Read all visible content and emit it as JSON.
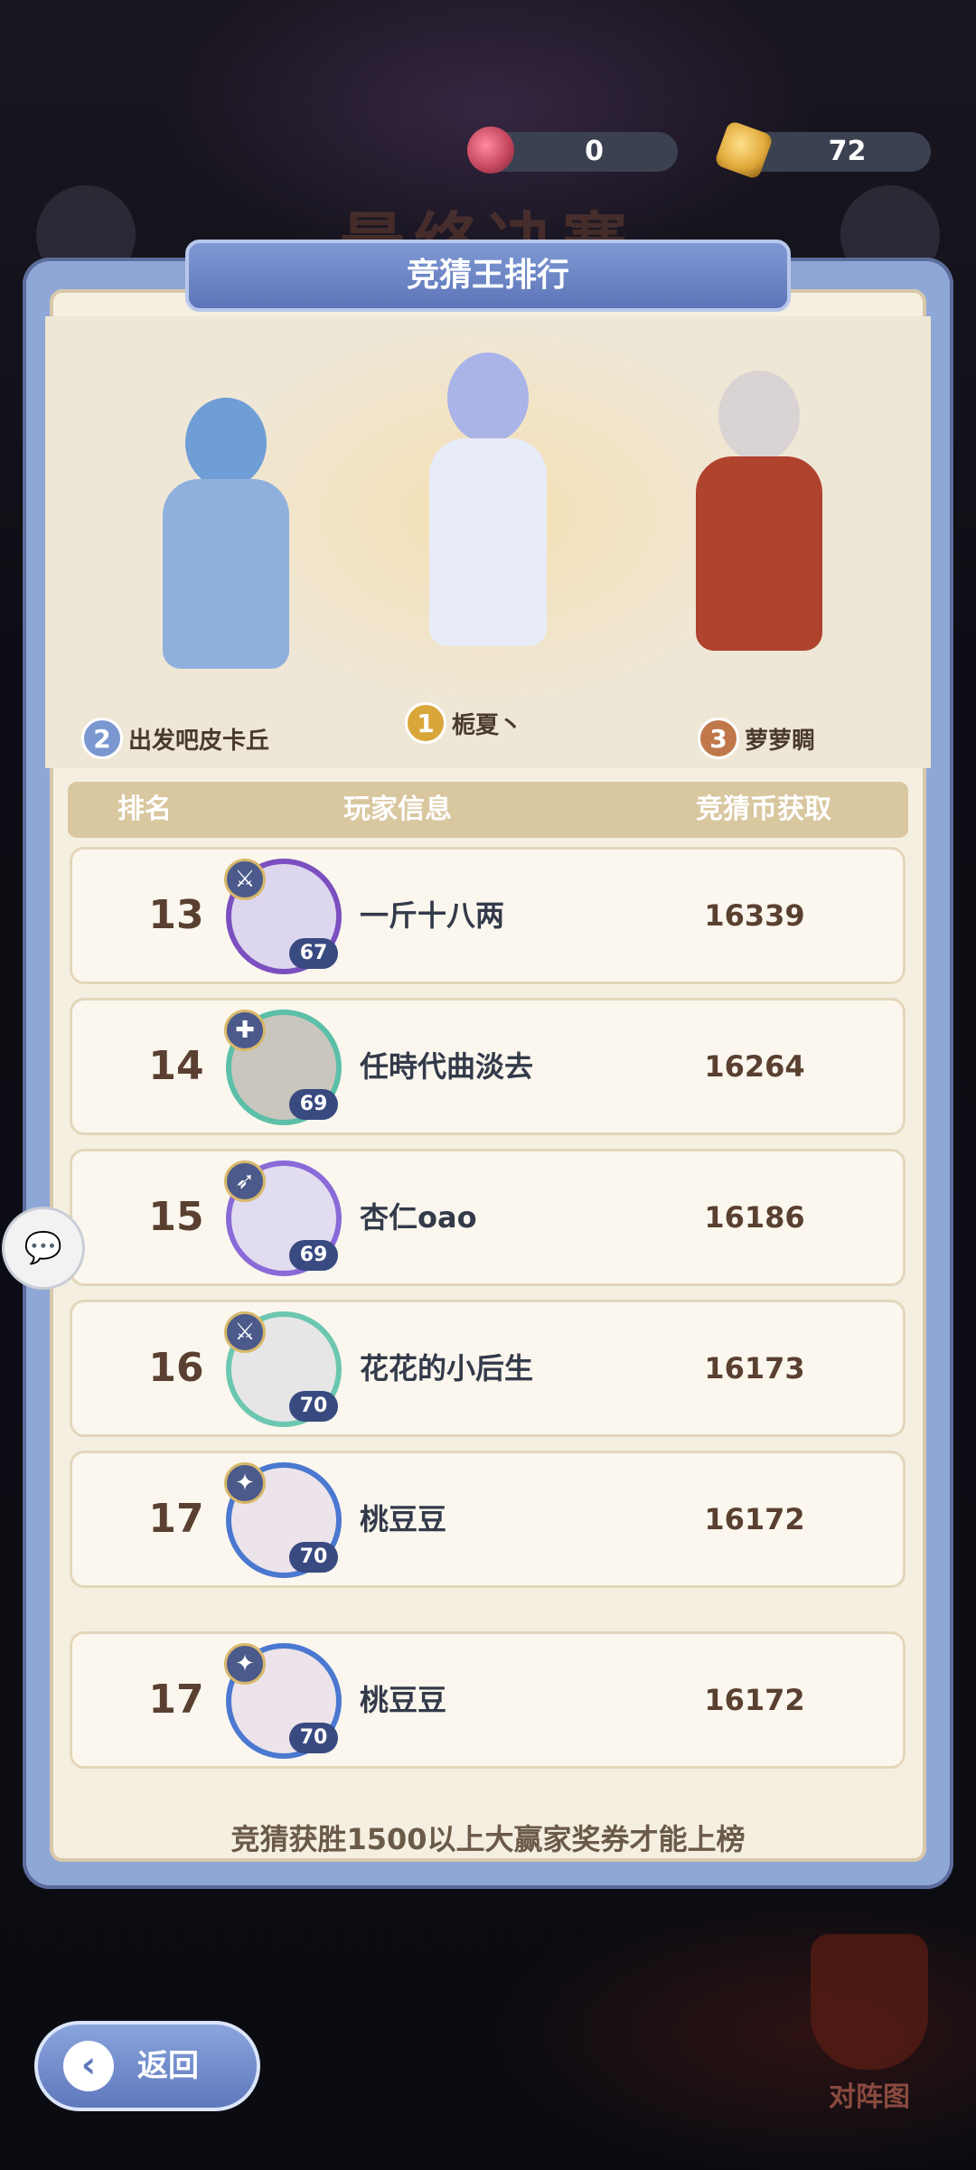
{
  "background": {
    "title": "最终决赛",
    "lineup_label": "对阵图"
  },
  "currency": [
    {
      "icon": "gem-coin-icon",
      "value": "0",
      "color": "#c0435a"
    },
    {
      "icon": "ticket-icon",
      "value": "72",
      "color": "#e0a93a"
    }
  ],
  "panel": {
    "title": "竞猜王排行"
  },
  "podium": [
    {
      "place": "2",
      "name": "出发吧皮卡丘"
    },
    {
      "place": "1",
      "name": "栀夏丶"
    },
    {
      "place": "3",
      "name": "萝萝睭"
    }
  ],
  "table": {
    "headers": {
      "rank": "排名",
      "player": "玩家信息",
      "coins": "竞猜币获取"
    },
    "rows": [
      {
        "rank": "13",
        "name": "一斤十八两",
        "level": "67",
        "score": "16339",
        "frame": "#7c4fc0"
      },
      {
        "rank": "14",
        "name": "任時代曲淡去",
        "level": "69",
        "score": "16264",
        "frame": "#5cbfa8"
      },
      {
        "rank": "15",
        "name": "杏仁oao",
        "level": "69",
        "score": "16186",
        "frame": "#8a6ad8"
      },
      {
        "rank": "16",
        "name": "花花的小后生",
        "level": "70",
        "score": "16173",
        "frame": "#6cc7b0"
      },
      {
        "rank": "17",
        "name": "桃豆豆",
        "level": "70",
        "score": "16172",
        "frame": "#4b78d0"
      },
      {
        "rank": "17",
        "name": "桃豆豆",
        "level": "70",
        "score": "16172",
        "frame": "#4b78d0"
      }
    ]
  },
  "footer_note": "竞猜获胜1500以上大赢家奖券才能上榜",
  "back_button": {
    "label": "返回"
  }
}
